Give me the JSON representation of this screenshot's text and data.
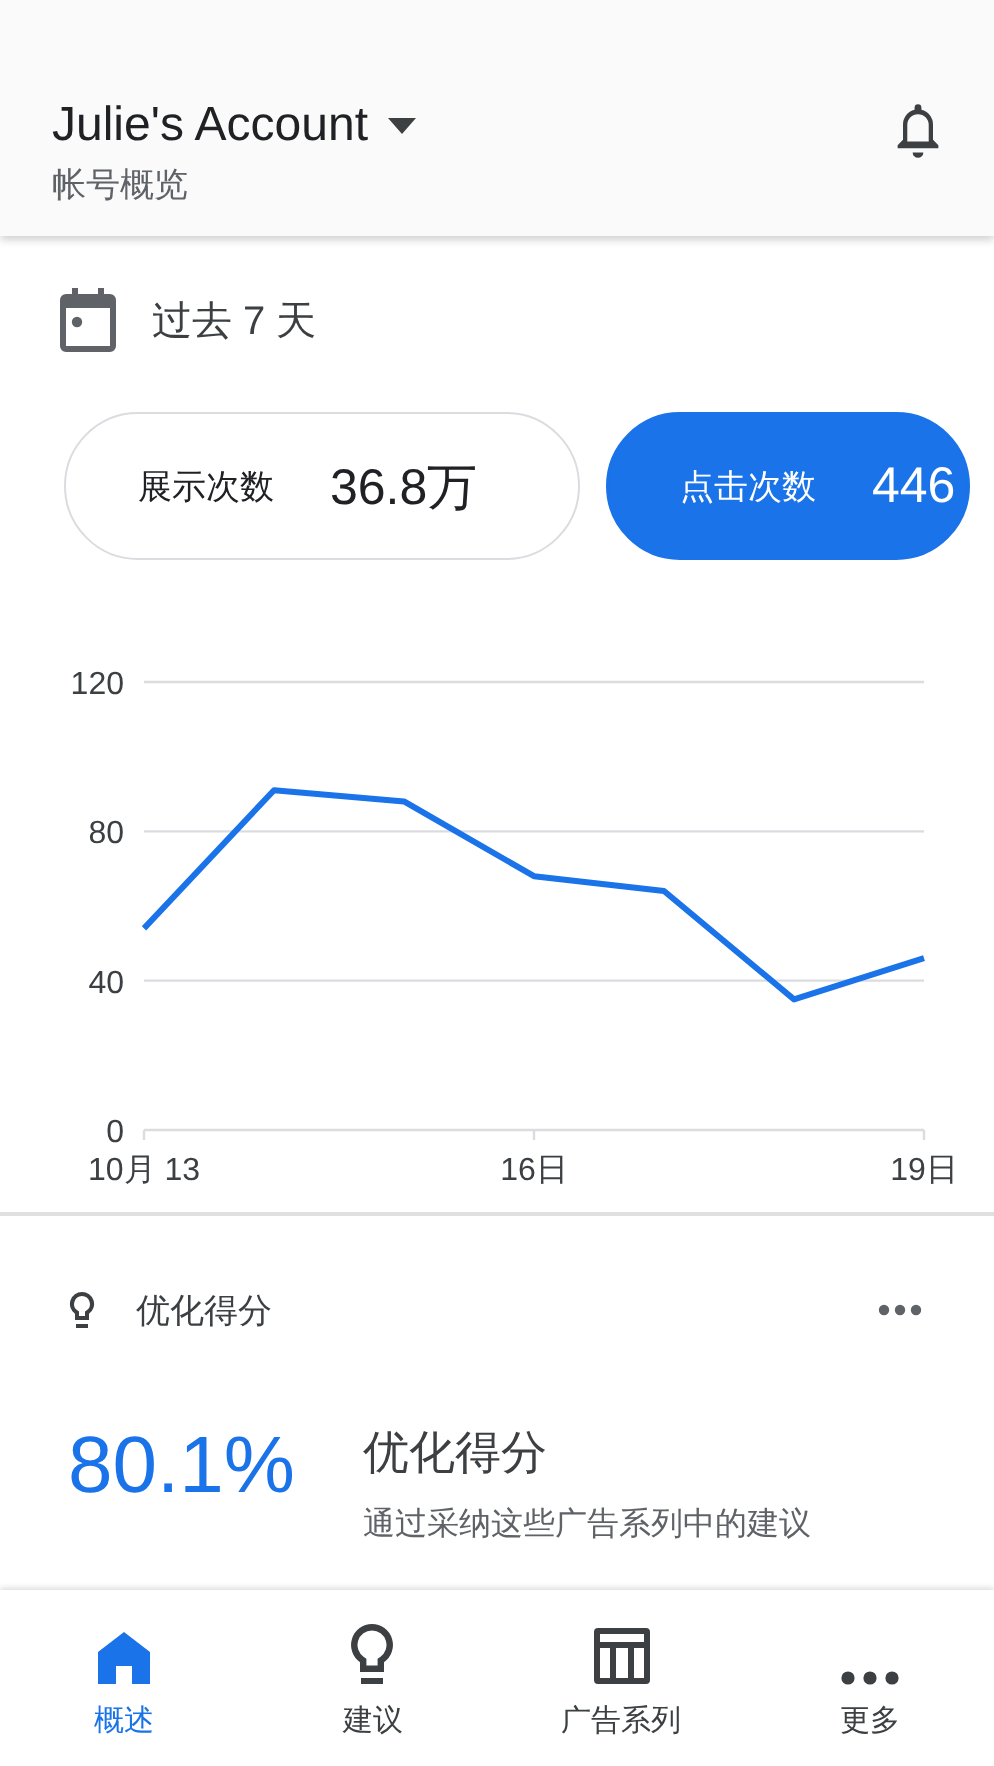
{
  "header": {
    "title": "Julie's Account",
    "subtitle": "帐号概览"
  },
  "date_range": {
    "label": "过去 7 天"
  },
  "metrics": [
    {
      "label": "展示次数",
      "value": "36.8万",
      "selected": false
    },
    {
      "label": "点击次数",
      "value": "446",
      "selected": true
    }
  ],
  "chart_data": {
    "type": "line",
    "x": [
      13,
      14,
      15,
      16,
      17,
      18,
      19
    ],
    "xticks": [
      {
        "value": 13,
        "label": "10月 13"
      },
      {
        "value": 16,
        "label": "16日"
      },
      {
        "value": 19,
        "label": "19日"
      }
    ],
    "xlim": [
      13,
      19
    ],
    "ylim": [
      0,
      120
    ],
    "yticks": [
      0,
      40,
      80,
      120
    ],
    "series": [
      {
        "color": "#1a73e8",
        "values": [
          54,
          91,
          88,
          68,
          64,
          35,
          46
        ]
      }
    ]
  },
  "optimization": {
    "heading": "优化得分",
    "score": "80.1%",
    "title": "优化得分",
    "description": "通过采纳这些广告系列中的建议"
  },
  "nav": [
    {
      "kind": "home",
      "label": "概述",
      "selected": true
    },
    {
      "kind": "bulb",
      "label": "建议",
      "selected": false
    },
    {
      "kind": "table",
      "label": "广告系列",
      "selected": false
    },
    {
      "kind": "more",
      "label": "更多",
      "selected": false
    }
  ]
}
